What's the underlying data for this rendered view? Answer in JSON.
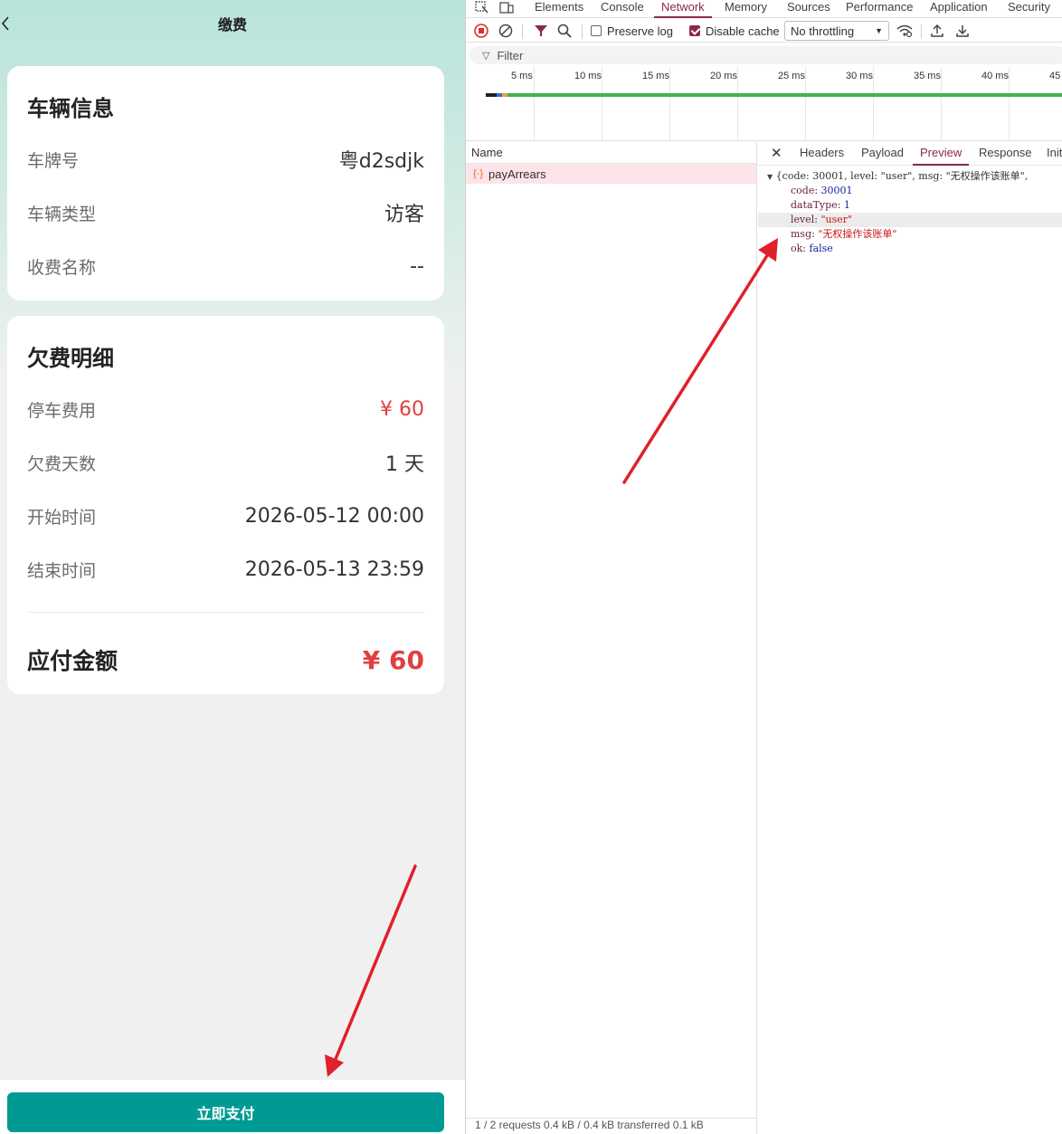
{
  "app": {
    "title": "缴费",
    "vehicle_card": {
      "title": "车辆信息",
      "rows": [
        {
          "label": "车牌号",
          "value": "粤d2sdjk"
        },
        {
          "label": "车辆类型",
          "value": "访客"
        },
        {
          "label": "收费名称",
          "value": "--"
        }
      ]
    },
    "arrears_card": {
      "title": "欠费明细",
      "rows": [
        {
          "label": "停车费用",
          "value": "¥ 60"
        },
        {
          "label": "欠费天数",
          "value": "1 天"
        },
        {
          "label": "开始时间",
          "value": "2026-05-12 00:00"
        },
        {
          "label": "结束时间",
          "value": "2026-05-13 23:59"
        }
      ],
      "total_label": "应付金额",
      "total_value": "¥ 60"
    },
    "pay_button": "立即支付"
  },
  "devtools": {
    "tabs": [
      "Elements",
      "Console",
      "Network",
      "Memory",
      "Sources",
      "Performance",
      "Application",
      "Security"
    ],
    "active_tab": "Network",
    "toolbar": {
      "preserve_log": "Preserve log",
      "disable_cache": "Disable cache",
      "throttling": "No throttling"
    },
    "filter_placeholder": "Filter",
    "timeline_ticks": [
      "5 ms",
      "10 ms",
      "15 ms",
      "20 ms",
      "25 ms",
      "30 ms",
      "35 ms",
      "40 ms",
      "45"
    ],
    "name_header": "Name",
    "request_name": "payArrears",
    "status_bar": "1 / 2 requests   0.4 kB / 0.4 kB transferred   0.1 kB",
    "detail_tabs": [
      "Headers",
      "Payload",
      "Preview",
      "Response",
      "Init"
    ],
    "active_detail_tab": "Preview",
    "preview": {
      "summary": "{code: 30001, level: \"user\", msg: \"无权操作该账单\",",
      "lines": [
        {
          "key": "code",
          "value": "30001",
          "type": "num"
        },
        {
          "key": "dataType",
          "value": "1",
          "type": "num"
        },
        {
          "key": "level",
          "value": "\"user\"",
          "type": "str"
        },
        {
          "key": "msg",
          "value": "\"无权操作该账单\"",
          "type": "str"
        },
        {
          "key": "ok",
          "value": "false",
          "type": "bool"
        }
      ]
    }
  },
  "colors": {
    "accent_teal": "#009a94",
    "amount_red": "#e04040",
    "devtools_accent": "#8a2a4a",
    "arrow_red": "#e0202a"
  }
}
